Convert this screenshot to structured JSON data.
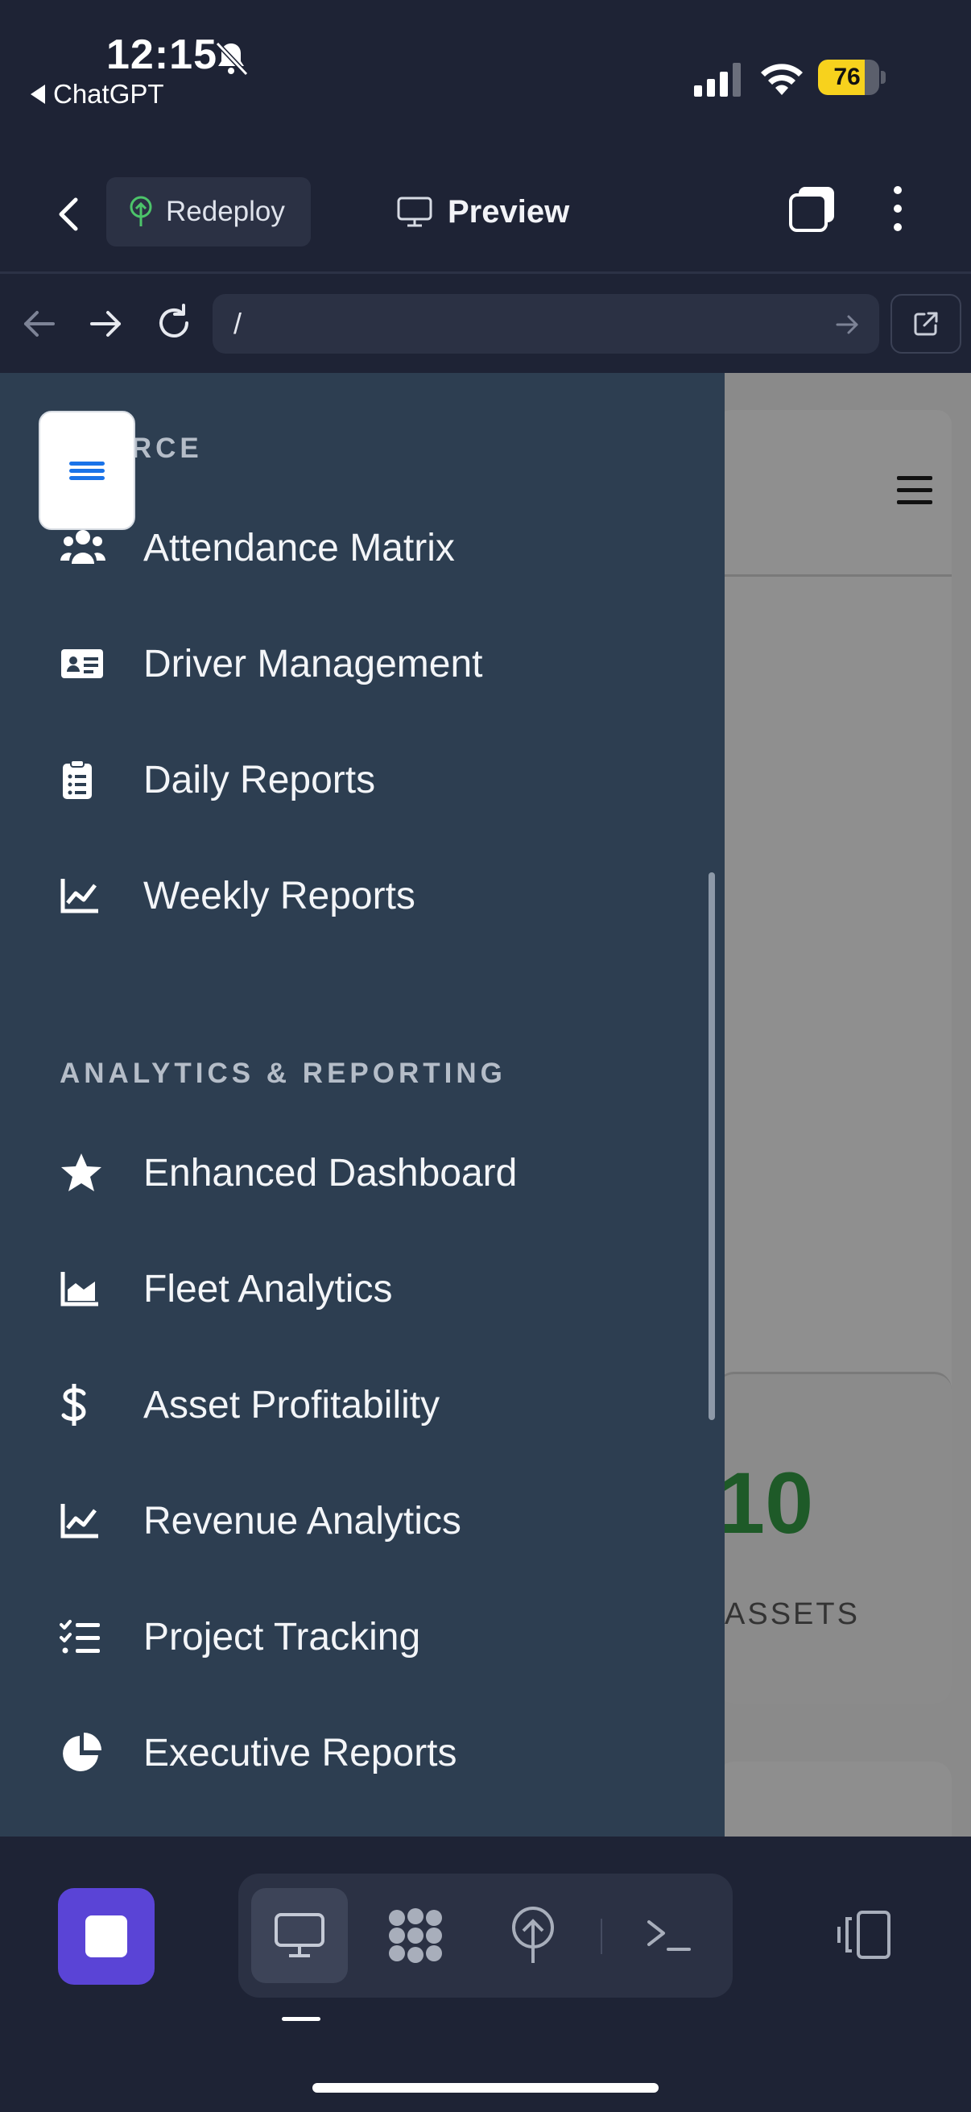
{
  "status_bar": {
    "time": "12:15",
    "back_app": "ChatGPT",
    "battery_percent": "76",
    "battery_level": 0.76
  },
  "app_bar": {
    "redeploy_label": "Redeploy",
    "preview_label": "Preview"
  },
  "url_bar": {
    "url": "/"
  },
  "sidebar": {
    "section_1_title": "KFORCE",
    "section_1_items": [
      {
        "label": "Attendance Matrix",
        "icon": "users-icon"
      },
      {
        "label": "Driver Management",
        "icon": "id-card-icon"
      },
      {
        "label": "Daily Reports",
        "icon": "clipboard-list-icon"
      },
      {
        "label": "Weekly Reports",
        "icon": "line-chart-icon"
      }
    ],
    "section_2_title": "ANALYTICS & REPORTING",
    "section_2_items": [
      {
        "label": "Enhanced Dashboard",
        "icon": "star-icon"
      },
      {
        "label": "Fleet Analytics",
        "icon": "area-chart-icon"
      },
      {
        "label": "Asset Profitability",
        "icon": "dollar-icon"
      },
      {
        "label": "Revenue Analytics",
        "icon": "line-chart-icon"
      },
      {
        "label": "Project Tracking",
        "icon": "task-list-icon"
      },
      {
        "label": "Executive Reports",
        "icon": "pie-chart-icon"
      }
    ]
  },
  "background_page": {
    "stat_value": "10",
    "stat_label": "ASSETS",
    "stat_color": "#1e5a28"
  },
  "colors": {
    "accent": "#5a44d6",
    "sidebar_bg": "#2d3e51",
    "chrome_bg": "#1e2335",
    "menu_icon": "#1a73e8"
  }
}
